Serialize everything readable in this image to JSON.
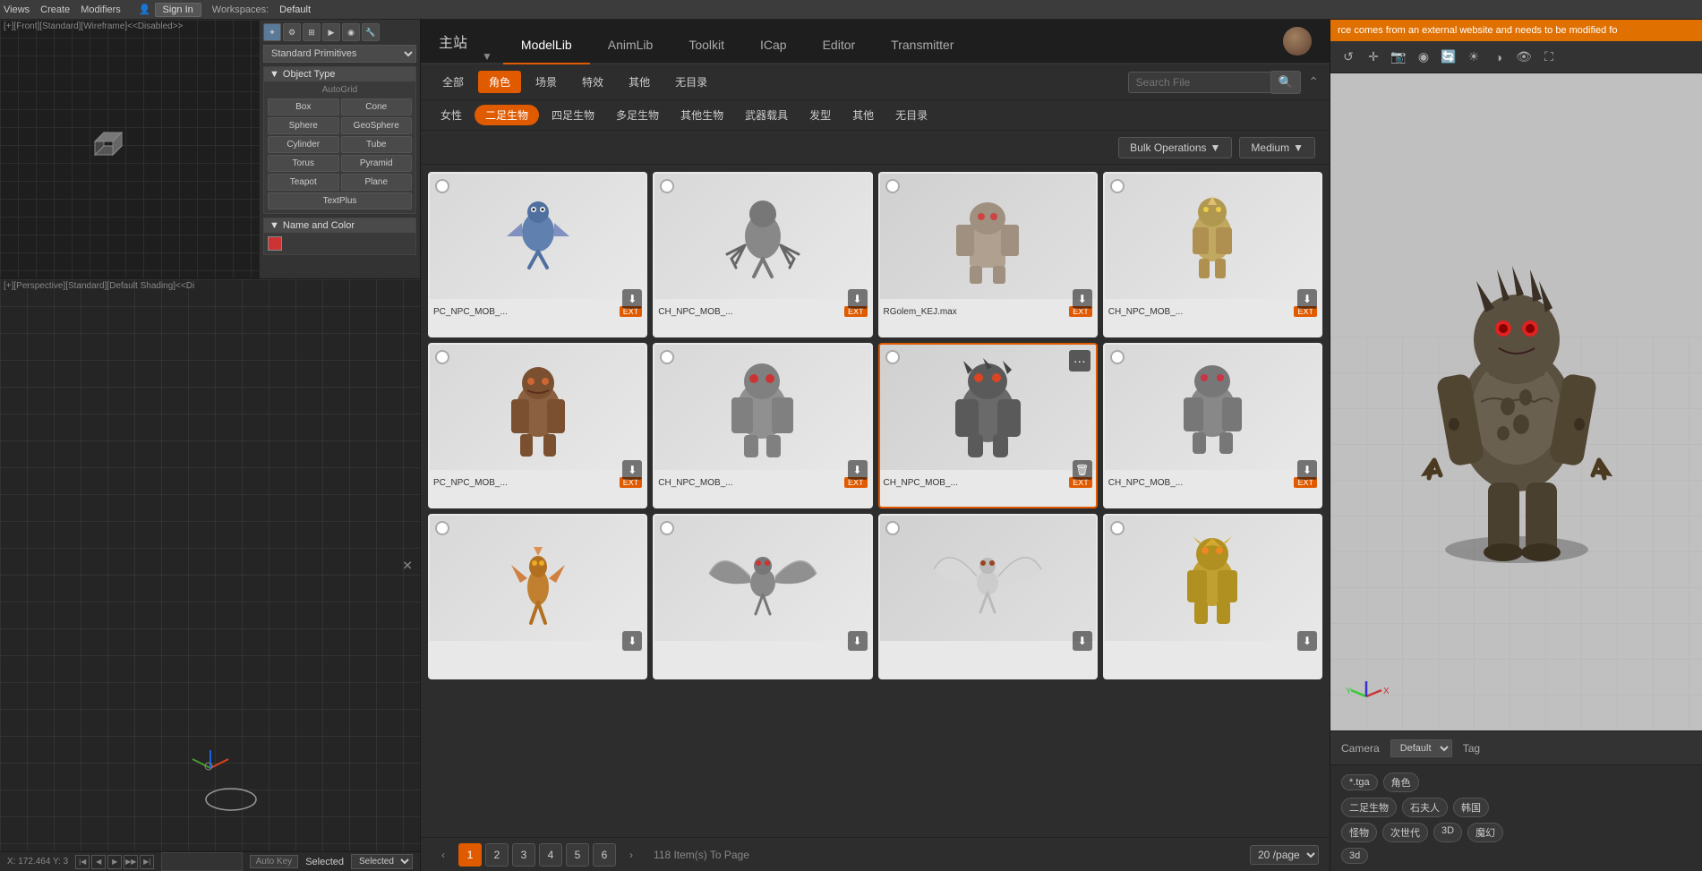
{
  "menubar": {
    "items": [
      "Views",
      "Create",
      "Modifiers"
    ],
    "sign_in": "Sign In",
    "workspaces_label": "Workspaces:",
    "workspace_name": "Default"
  },
  "toolbar": {
    "view_label": "View"
  },
  "left_panel": {
    "viewport_front_label": "[+][Front][Standard][Wireframe]<<Disabled>>",
    "viewport_persp_label": "[+][Perspective][Standard][Default Shading]<<Di",
    "standard_primitives_label": "Standard Primitives",
    "object_type_label": "Object Type",
    "autogrid_label": "AutoGrid",
    "primitives": [
      "Box",
      "Cone",
      "Sphere",
      "GeoSphere",
      "Cylinder",
      "Tube",
      "Torus",
      "Pyramid",
      "Teapot",
      "Plane",
      "TextPlus"
    ],
    "name_color_label": "Name and Color"
  },
  "modellib": {
    "app_title": "主站",
    "tabs": [
      "ModelLib",
      "AnimLib",
      "Toolkit",
      "ICap",
      "Editor",
      "Transmitter"
    ],
    "active_tab": "ModelLib",
    "search_placeholder": "Search File",
    "categories": [
      "全部",
      "角色",
      "场景",
      "特效",
      "其他",
      "无目录"
    ],
    "active_category": "角色",
    "subcategories": [
      "女性",
      "二足生物",
      "四足生物",
      "多足生物",
      "其他生物",
      "武器载具",
      "发型",
      "其他",
      "无目录"
    ],
    "active_subcategory": "二足生物",
    "bulk_ops_label": "Bulk Operations",
    "medium_label": "Medium",
    "assets": [
      {
        "name": "PC_NPC_MOB_...",
        "ext": "EXT",
        "selected": false,
        "row": 1,
        "checked": false
      },
      {
        "name": "CH_NPC_MOB_...",
        "ext": "EXT",
        "selected": false,
        "row": 1,
        "checked": false
      },
      {
        "name": "RGolem_KEJ.max",
        "ext": "EXT",
        "selected": false,
        "row": 1,
        "checked": false
      },
      {
        "name": "CH_NPC_MOB_...",
        "ext": "EXT",
        "selected": false,
        "row": 1,
        "checked": false
      },
      {
        "name": "PC_NPC_MOB_...",
        "ext": "EXT",
        "selected": false,
        "row": 2,
        "checked": false
      },
      {
        "name": "CH_NPC_MOB_...",
        "ext": "EXT",
        "selected": false,
        "row": 2,
        "checked": false
      },
      {
        "name": "CH_NPC_MOB_...",
        "ext": "EXT",
        "selected": true,
        "row": 2,
        "checked": false
      },
      {
        "name": "CH_NPC_MOB_...",
        "ext": "EXT",
        "selected": false,
        "row": 2,
        "checked": false
      },
      {
        "name": "",
        "ext": "",
        "selected": false,
        "row": 3,
        "checked": false
      },
      {
        "name": "",
        "ext": "",
        "selected": false,
        "row": 3,
        "checked": false
      },
      {
        "name": "",
        "ext": "",
        "selected": false,
        "row": 3,
        "checked": false
      },
      {
        "name": "",
        "ext": "",
        "selected": false,
        "row": 3,
        "checked": false
      }
    ],
    "pagination": {
      "pages": [
        1,
        2,
        3,
        4,
        5,
        6
      ],
      "active_page": 1,
      "total_items": "118 Item(s) To Page",
      "per_page": "20 /page"
    }
  },
  "preview": {
    "warning_text": "rce comes from an external website and needs to be modified fo",
    "camera_label": "Camera",
    "camera_value": "Default",
    "tag_label": "Tag",
    "tags": [
      "*.tga",
      "角色",
      "二足生物",
      "石夫人",
      "韩国",
      "怪物",
      "次世代",
      "3D",
      "魔幻",
      "3d"
    ]
  },
  "status_bar": {
    "coords": "X: 172.464    Y: 3",
    "autokey": "Auto Key",
    "selected": "Selected"
  }
}
